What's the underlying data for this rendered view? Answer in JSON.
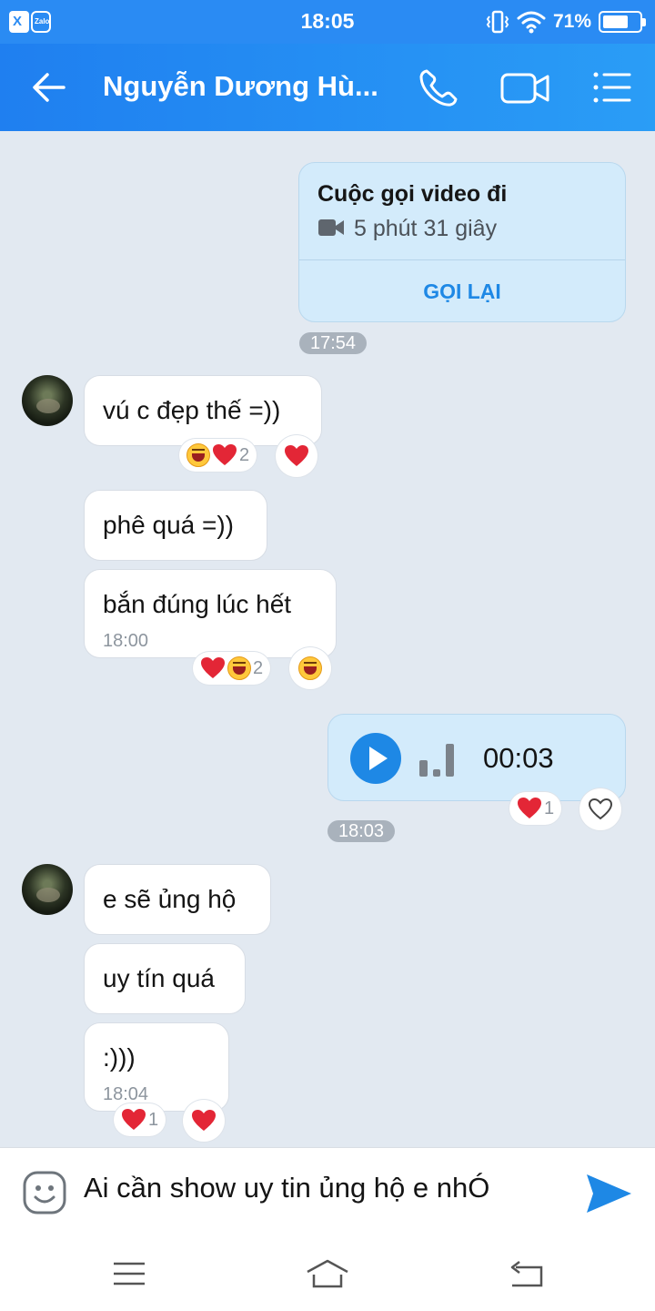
{
  "status_bar": {
    "time": "18:05",
    "battery": "71%",
    "battery_level": 0.71
  },
  "header": {
    "contact_name": "Nguyễn Dương Hù..."
  },
  "call_card": {
    "title": "Cuộc gọi video đi",
    "duration": "5 phút 31 giây",
    "action": "GỌI LẠI",
    "time": "17:54"
  },
  "messages": [
    {
      "text": "vú c đẹp thế =))",
      "reaction_count": "2"
    },
    {
      "text": "phê quá =))"
    },
    {
      "text": "bắn đúng lúc hết",
      "time": "18:00",
      "reaction_count": "2"
    },
    {
      "text": "e sẽ ủng hộ"
    },
    {
      "text": "uy tín quá"
    },
    {
      "text": ":)))",
      "time": "18:04",
      "reaction_count": "1"
    }
  ],
  "voice_message": {
    "duration": "00:03",
    "time": "18:03",
    "reaction_count": "1"
  },
  "composer": {
    "text": "Ai cần show uy tin ủng hộ e nhÓ"
  },
  "colors": {
    "brand": "#1e88e5",
    "header_start": "#1f7ff0",
    "header_end": "#2a9df6",
    "chat_background": "#e2e9f1",
    "outgoing_bubble": "#d3ebfb",
    "heart": "#e32636"
  }
}
